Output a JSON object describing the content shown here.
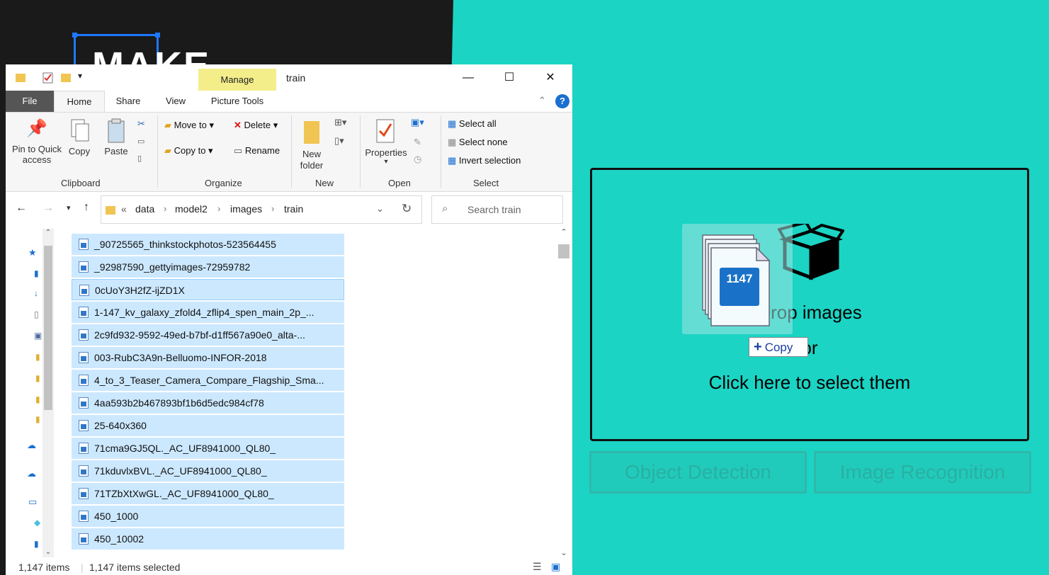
{
  "background_app": {
    "logo_text": "MAKE",
    "drop_zone": {
      "line1": "Drop images",
      "line2": "or",
      "line3": "Click here to select them"
    },
    "buttons": {
      "object_detection": "Object Detection",
      "image_recognition": "Image Recognition"
    },
    "colors": {
      "teal": "#1bd4c4",
      "dark": "#1a1a1a",
      "accent_blue": "#1e78ff"
    }
  },
  "drag": {
    "count": "1147",
    "effect_label": "Copy",
    "effect_icon": "plus-icon"
  },
  "explorer": {
    "title": "train",
    "manage_tab": "Manage",
    "tabs": [
      "File",
      "Home",
      "Share",
      "View",
      "Picture Tools"
    ],
    "ribbon": {
      "clipboard": {
        "label": "Clipboard",
        "pin": "Pin to Quick access",
        "copy": "Copy",
        "paste": "Paste"
      },
      "organize": {
        "label": "Organize",
        "move_to": "Move to",
        "copy_to": "Copy to",
        "delete": "Delete",
        "rename": "Rename"
      },
      "new": {
        "label": "New",
        "new_folder": "New folder"
      },
      "open": {
        "label": "Open",
        "properties": "Properties"
      },
      "select": {
        "label": "Select",
        "select_all": "Select all",
        "select_none": "Select none",
        "invert": "Invert selection"
      }
    },
    "breadcrumb": [
      "«",
      "data",
      "model2",
      "images",
      "train"
    ],
    "search_placeholder": "Search train",
    "files": [
      "_90725565_thinkstockphotos-523564455",
      "_92987590_gettyimages-72959782",
      "0cUoY3H2fZ-ijZD1X",
      "1-147_kv_galaxy_zfold4_zflip4_spen_main_2p_...",
      "2c9fd932-9592-49ed-b7bf-d1ff567a90e0_alta-...",
      "003-RubC3A9n-Belluomo-INFOR-2018",
      "4_to_3_Teaser_Camera_Compare_Flagship_Sma...",
      "4aa593b2b467893bf1b6d5edc984cf78",
      "25-640x360",
      "71cma9GJ5QL._AC_UF8941000_QL80_",
      "71kduvlxBVL._AC_UF8941000_QL80_",
      "71TZbXtXwGL._AC_UF8941000_QL80_",
      "450_1000",
      "450_10002"
    ],
    "status": {
      "items": "1,147 items",
      "selected": "1,147 items selected"
    }
  }
}
